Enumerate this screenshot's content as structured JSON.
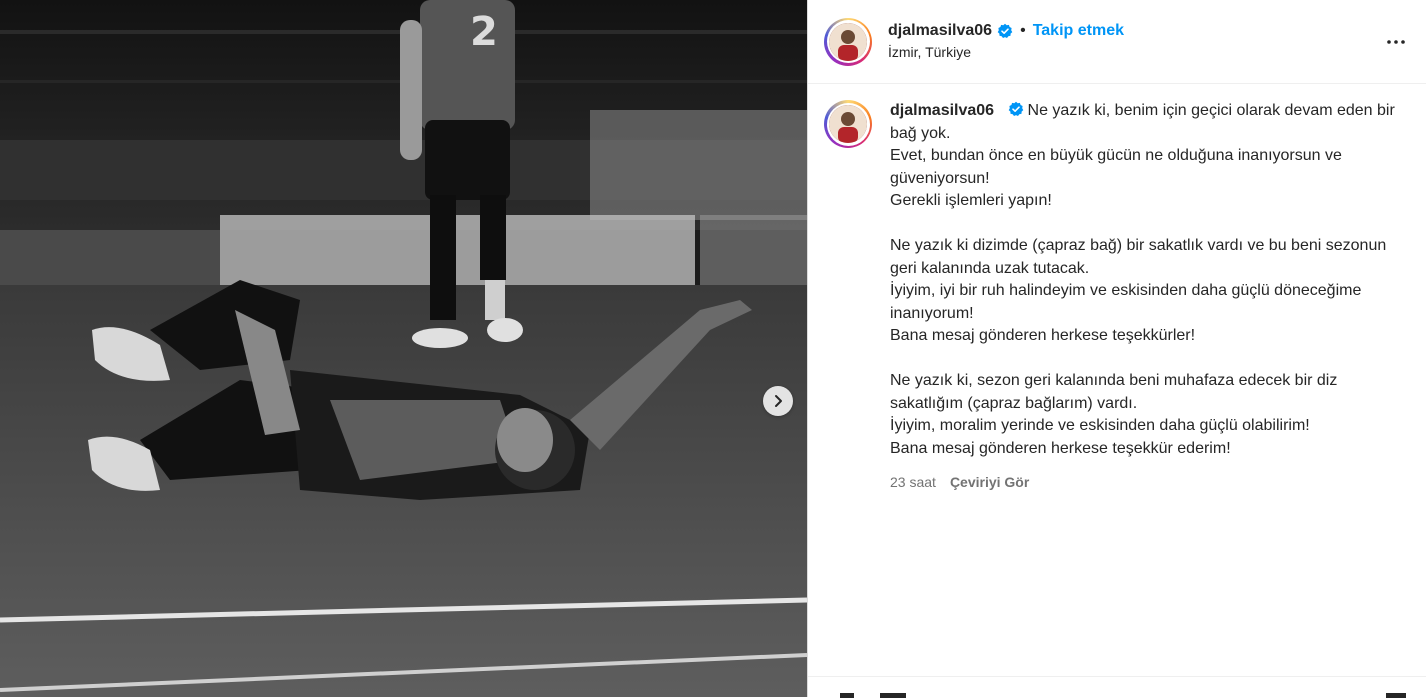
{
  "media": {
    "next_icon": "chevron-right-icon",
    "jersey_number": "2"
  },
  "header": {
    "username": "djalmasilva06",
    "verified_icon": "verified-badge-icon",
    "separator": "•",
    "follow_label": "Takip etmek",
    "location": "İzmir, Türkiye",
    "more_icon": "more-options-icon"
  },
  "caption": {
    "username": "djalmasilva06",
    "paragraphs": [
      [
        "Ne yazık ki, benim için geçici olarak devam eden bir bağ yok.",
        "Evet, bundan önce en büyük gücün ne olduğuna inanıyorsun ve güveniyorsun!",
        "Gerekli işlemleri yapın!"
      ],
      [
        "Ne yazık ki dizimde (çapraz bağ) bir sakatlık vardı ve bu beni sezonun geri kalanında uzak tutacak.",
        "İyiyim, iyi bir ruh halindeyim ve eskisinden daha güçlü döneceğime inanıyorum!",
        "Bana mesaj gönderen herkese teşekkürler!"
      ],
      [
        "Ne yazık ki, sezon geri kalanında beni muhafaza edecek bir diz sakatlığım (çapraz bağlarım) vardı.",
        "İyiyim, moralim yerinde ve eskisinden daha güçlü olabilirim!",
        "Bana mesaj gönderen herkese teşekkür ederim!"
      ]
    ],
    "time": "23 saat",
    "translate_label": "Çeviriyi Gör"
  },
  "colors": {
    "link_blue": "#0095f6",
    "text": "#262626",
    "muted": "#737373",
    "border": "#dbdbdb"
  }
}
